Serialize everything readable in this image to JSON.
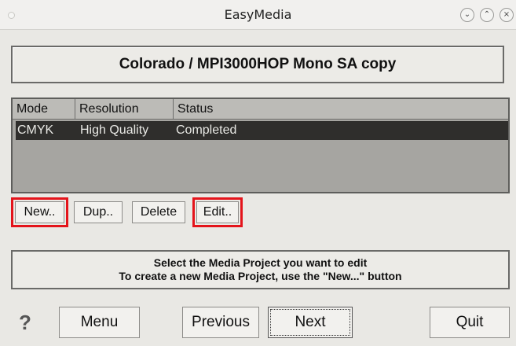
{
  "window": {
    "title": "EasyMedia",
    "controls": {
      "minimize": "⌄",
      "maximize": "⌃",
      "close": "×"
    }
  },
  "project": {
    "title": "Colorado / MPI3000HOP Mono SA copy"
  },
  "media_list": {
    "columns": [
      "Mode",
      "Resolution",
      "Status"
    ],
    "rows": [
      {
        "mode": "CMYK",
        "resolution": "High Quality",
        "status": "Completed",
        "selected": true
      }
    ]
  },
  "actions": {
    "new_label": "New..",
    "dup_label": "Dup..",
    "delete_label": "Delete",
    "edit_label": "Edit.."
  },
  "message": {
    "line1": "Select the Media Project you want to edit",
    "line2": "To create a new Media Project, use the \"New...\" button"
  },
  "footer": {
    "help_label": "?",
    "menu_label": "Menu",
    "previous_label": "Previous",
    "next_label": "Next",
    "quit_label": "Quit"
  },
  "colors": {
    "highlight": "#e4141b",
    "selected_row": "#2f2e2c",
    "list_background": "#a6a5a1"
  }
}
